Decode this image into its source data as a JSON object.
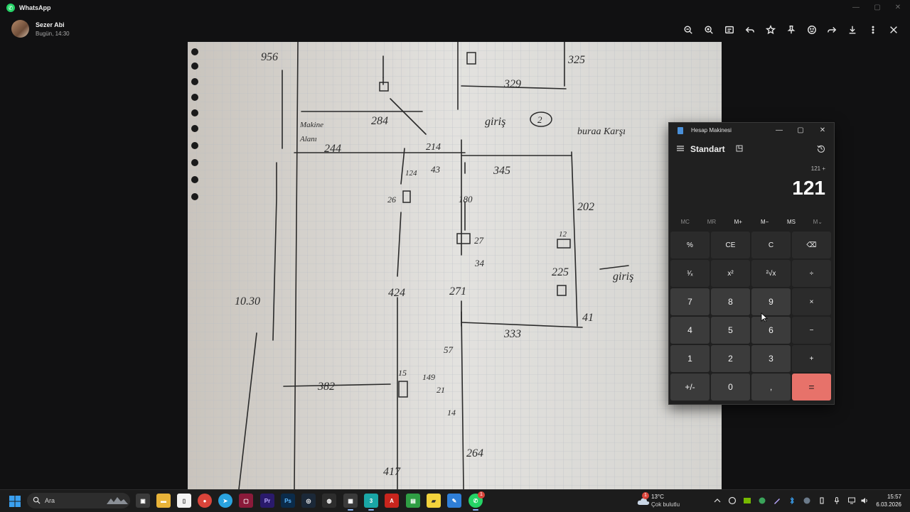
{
  "whatsapp": {
    "app_title": "WhatsApp",
    "sender_name": "Sezer Abi",
    "sender_time": "Bugün, 14:30"
  },
  "photo_notes": {
    "labels": [
      "956",
      "325",
      "329",
      "giriş",
      "2",
      "Makine",
      "Alanı",
      "284",
      "244",
      "214",
      "buraa Karşı",
      "43",
      "345",
      "202",
      "124",
      "26",
      "180",
      "27",
      "34",
      "12",
      "225",
      "giriş",
      "424",
      "271",
      "41",
      "10.30",
      "333",
      "57",
      "15",
      "149",
      "382",
      "21",
      "14",
      "264",
      "417"
    ]
  },
  "calculator": {
    "window_title": "Hesap Makinesi",
    "mode": "Standart",
    "expression": "121 +",
    "display": "121",
    "memory": [
      "MC",
      "MR",
      "M+",
      "M−",
      "MS",
      "M⌄"
    ],
    "keys": [
      "%",
      "CE",
      "C",
      "⌫",
      "¹⁄ₓ",
      "x²",
      "²√x",
      "÷",
      "7",
      "8",
      "9",
      "×",
      "4",
      "5",
      "6",
      "−",
      "1",
      "2",
      "3",
      "+",
      "+/-",
      "0",
      ",",
      "="
    ]
  },
  "taskbar": {
    "search_placeholder": "Ara",
    "weather_temp": "13°C",
    "weather_desc": "Çok bulutlu",
    "weather_badge": "1",
    "clock_time": "15:57",
    "clock_date": "6.03.2026",
    "whatsapp_badge": "1"
  }
}
